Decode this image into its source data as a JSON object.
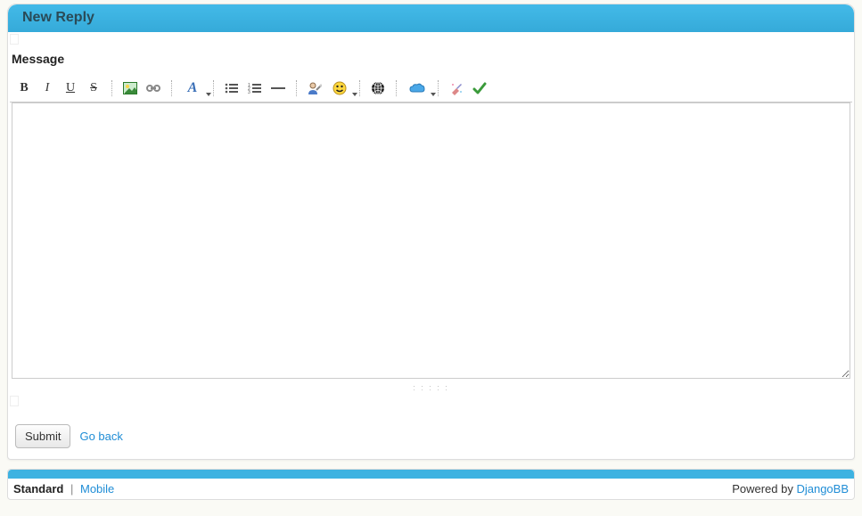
{
  "header": {
    "title": "New Reply"
  },
  "form": {
    "message_label": "Message",
    "body": ""
  },
  "toolbar": {
    "bold": "B",
    "italic": "I",
    "underline": "U",
    "strike": "S",
    "image": "image-icon",
    "link": "link-icon",
    "font": "A",
    "ul": "ul-icon",
    "ol": "ol-icon",
    "hr": "hr-icon",
    "user": "user-icon",
    "smiley": "smiley-icon",
    "globe": "globe-icon",
    "cloud": "cloud-icon",
    "clean": "clean-icon",
    "check": "check-icon"
  },
  "actions": {
    "submit": "Submit",
    "goback": "Go back"
  },
  "footer": {
    "standard": "Standard",
    "separator": "|",
    "mobile": "Mobile",
    "powered": "Powered by ",
    "project": "DjangoBB"
  }
}
